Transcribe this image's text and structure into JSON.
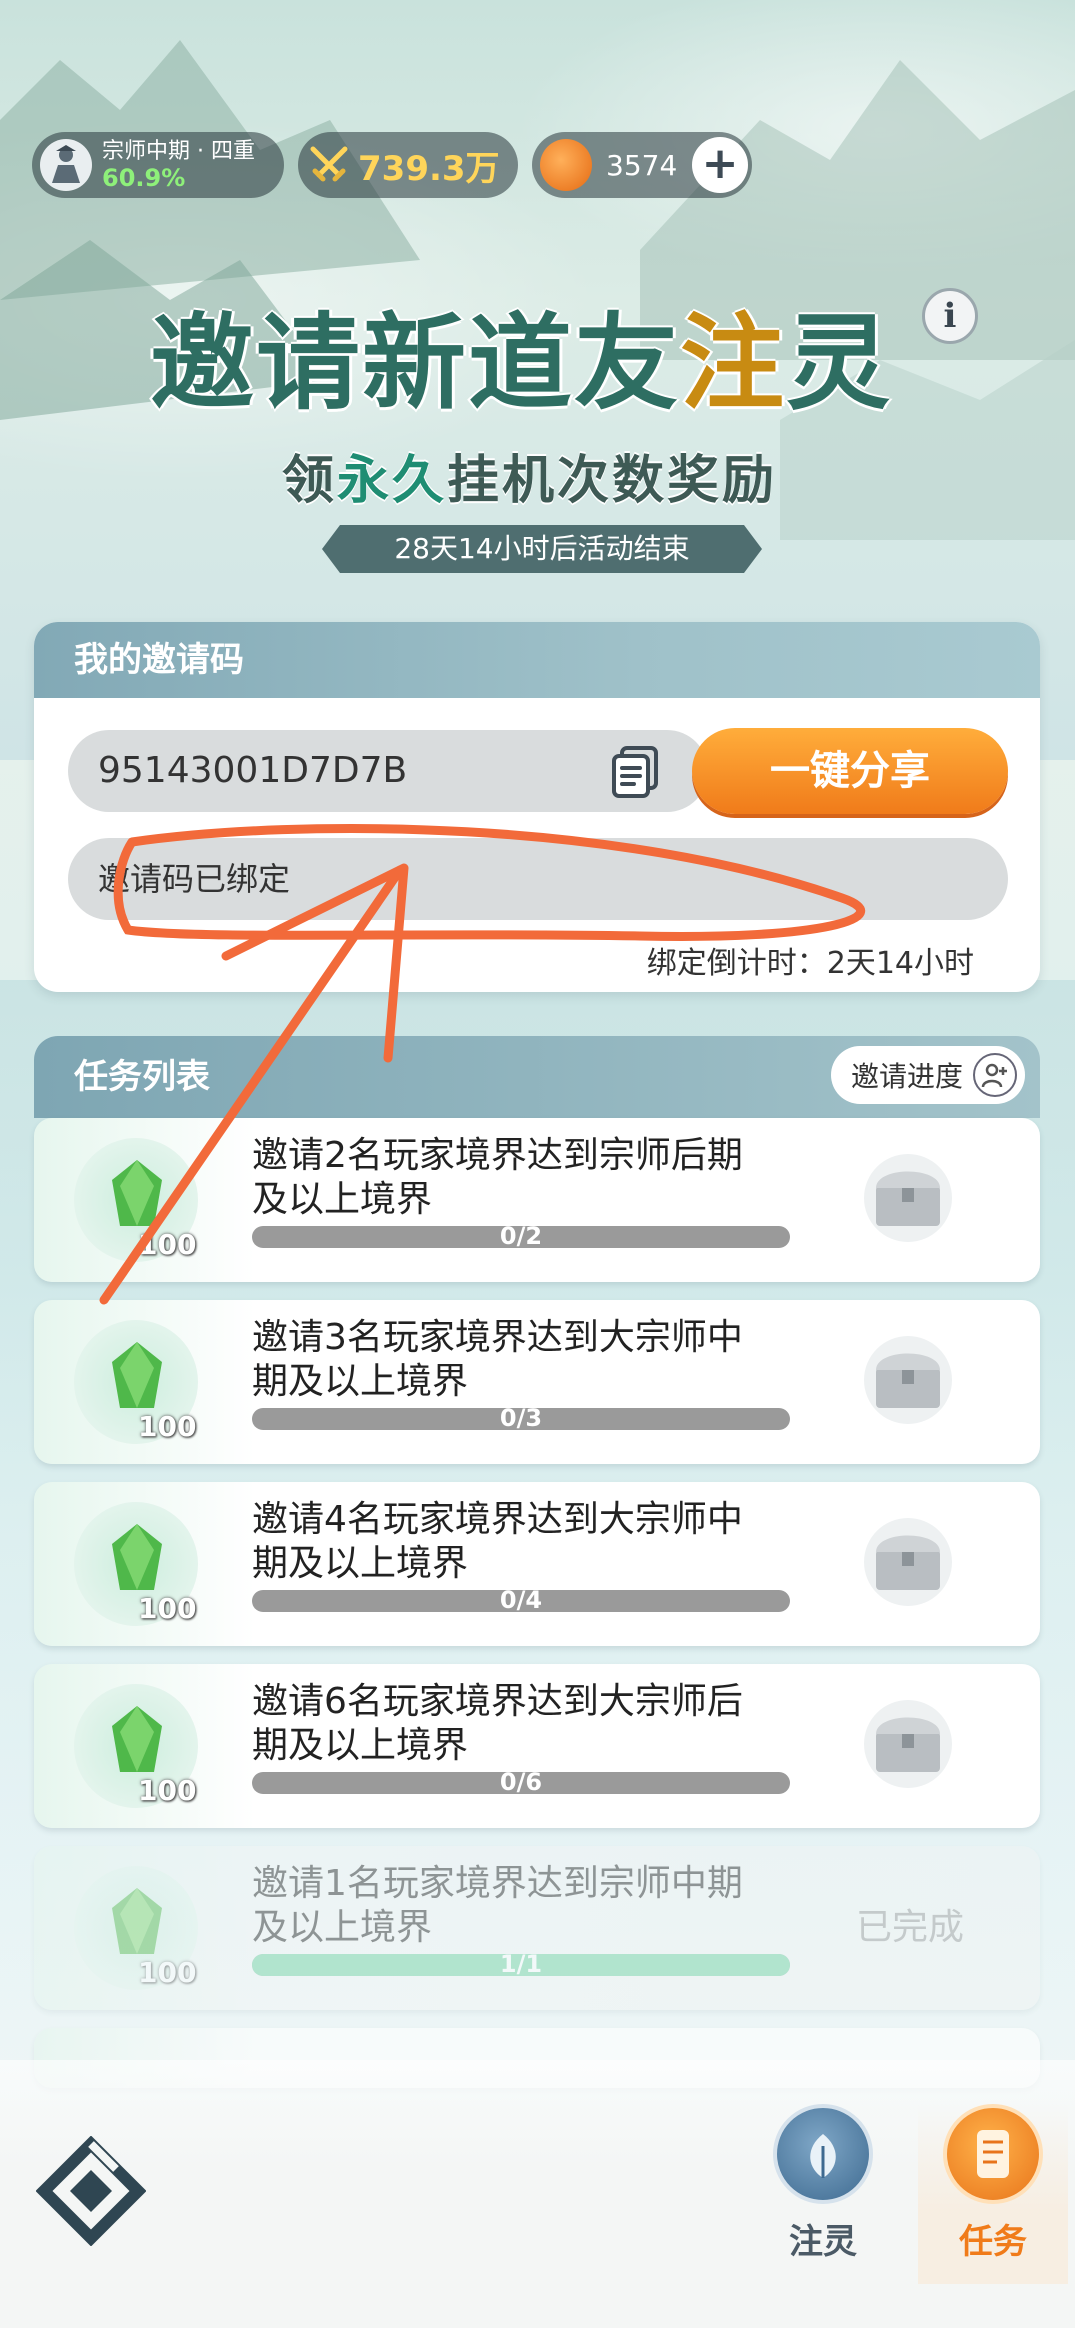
{
  "status_bar": {
    "rank_name": "宗师中期 · 四重",
    "rank_progress": "60.9%",
    "power": "739.3万",
    "coins": "3574",
    "add_label": "+"
  },
  "header": {
    "title_part1": "邀请新道友",
    "title_gold": "注",
    "title_part2": "灵",
    "info_label": "i",
    "subtitle_part1": "领",
    "subtitle_accent": "永久",
    "subtitle_part2": "挂机次数奖励",
    "countdown": "28天14小时后活动结束"
  },
  "invite": {
    "title": "我的邀请码",
    "code": "95143001D7D7B",
    "share_label": "一键分享",
    "bound_text": "邀请码已绑定",
    "bind_timer": "绑定倒计时：2天14小时"
  },
  "tasks": {
    "title": "任务列表",
    "progress_label": "邀请进度",
    "items": [
      {
        "text": "邀请2名玩家境界达到宗师后期及以上境界",
        "reward": "100",
        "progress": "0/2",
        "fraction": 0,
        "done": false
      },
      {
        "text": "邀请3名玩家境界达到大宗师中期及以上境界",
        "reward": "100",
        "progress": "0/3",
        "fraction": 0,
        "done": false
      },
      {
        "text": "邀请4名玩家境界达到大宗师中期及以上境界",
        "reward": "100",
        "progress": "0/4",
        "fraction": 0,
        "done": false
      },
      {
        "text": "邀请6名玩家境界达到大宗师后期及以上境界",
        "reward": "100",
        "progress": "0/6",
        "fraction": 0,
        "done": false
      },
      {
        "text": "邀请1名玩家境界达到宗师中期及以上境界",
        "reward": "100",
        "progress": "1/1",
        "fraction": 1,
        "done": true,
        "done_label": "已完成"
      }
    ]
  },
  "nav": {
    "zhuling": "注灵",
    "task": "任务"
  },
  "icons": {
    "rank": "rank-avatar-icon",
    "power": "crossed-swords-icon",
    "coin": "coin-icon",
    "copy": "copy-icon",
    "reward": "green-gem-icon",
    "chest": "treasure-chest-icon",
    "logo": "app-logo-icon"
  },
  "colors": {
    "accent_orange": "#f07b1a",
    "annotation": "#f26a3a",
    "title_green": "#2e6e62",
    "progress_done": "#6ed0a0"
  }
}
